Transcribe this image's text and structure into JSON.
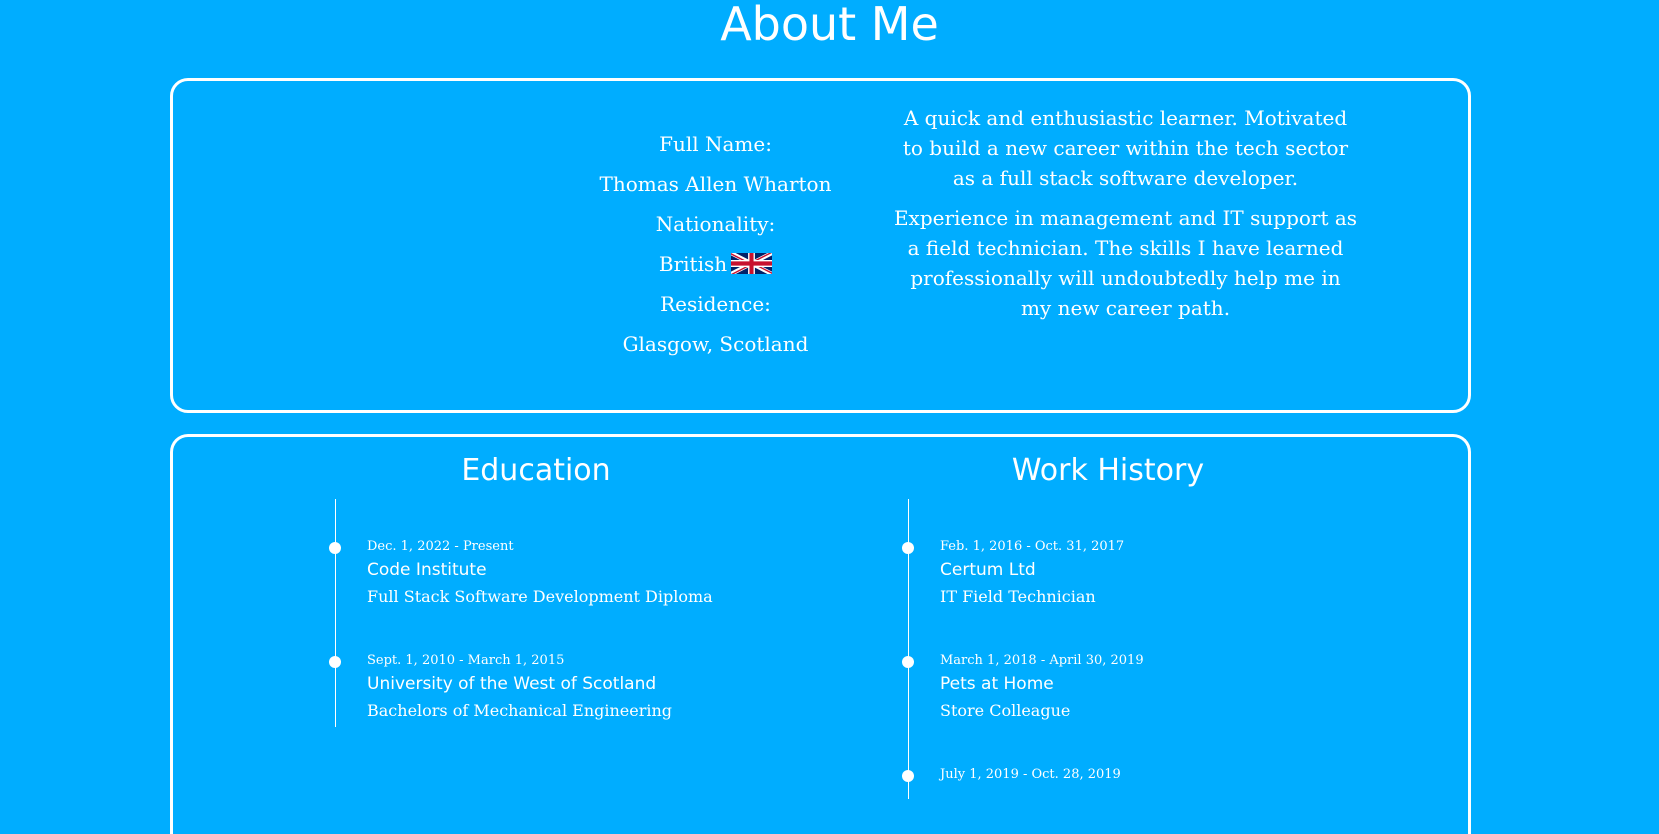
{
  "page": {
    "title": "About Me"
  },
  "details": {
    "name_label": "Full Name:",
    "name_value": "Thomas Allen Wharton",
    "nationality_label": "Nationality:",
    "nationality_value": "British",
    "residence_label": "Residence:",
    "residence_value": "Glasgow, Scotland",
    "flag_icon": "uk-flag-icon"
  },
  "bio": {
    "paragraph_1": "A quick and enthusiastic learner. Motivated to build a new career within the tech sector as a full stack software developer.",
    "paragraph_2": "Experience in management and IT support as a field technician. The skills I have learned professionally will undoubtedly help me in my new career path."
  },
  "education": {
    "title": "Education",
    "entries": [
      {
        "dates": "Dec. 1, 2022 - Present",
        "org": "Code Institute",
        "role": "Full Stack Software Development Diploma"
      },
      {
        "dates": "Sept. 1, 2010 - March 1, 2015",
        "org": "University of the West of Scotland",
        "role": "Bachelors of Mechanical Engineering"
      }
    ]
  },
  "work": {
    "title": "Work History",
    "entries": [
      {
        "dates": "Feb. 1, 2016 - Oct. 31, 2017",
        "org": "Certum Ltd",
        "role": "IT Field Technician"
      },
      {
        "dates": "March 1, 2018 - April 30, 2019",
        "org": "Pets at Home",
        "role": "Store Colleague"
      },
      {
        "dates": "July 1, 2019 - Oct. 28, 2019",
        "org": "",
        "role": ""
      }
    ]
  },
  "colors": {
    "background": "#00adff",
    "foreground": "#ffffff"
  }
}
